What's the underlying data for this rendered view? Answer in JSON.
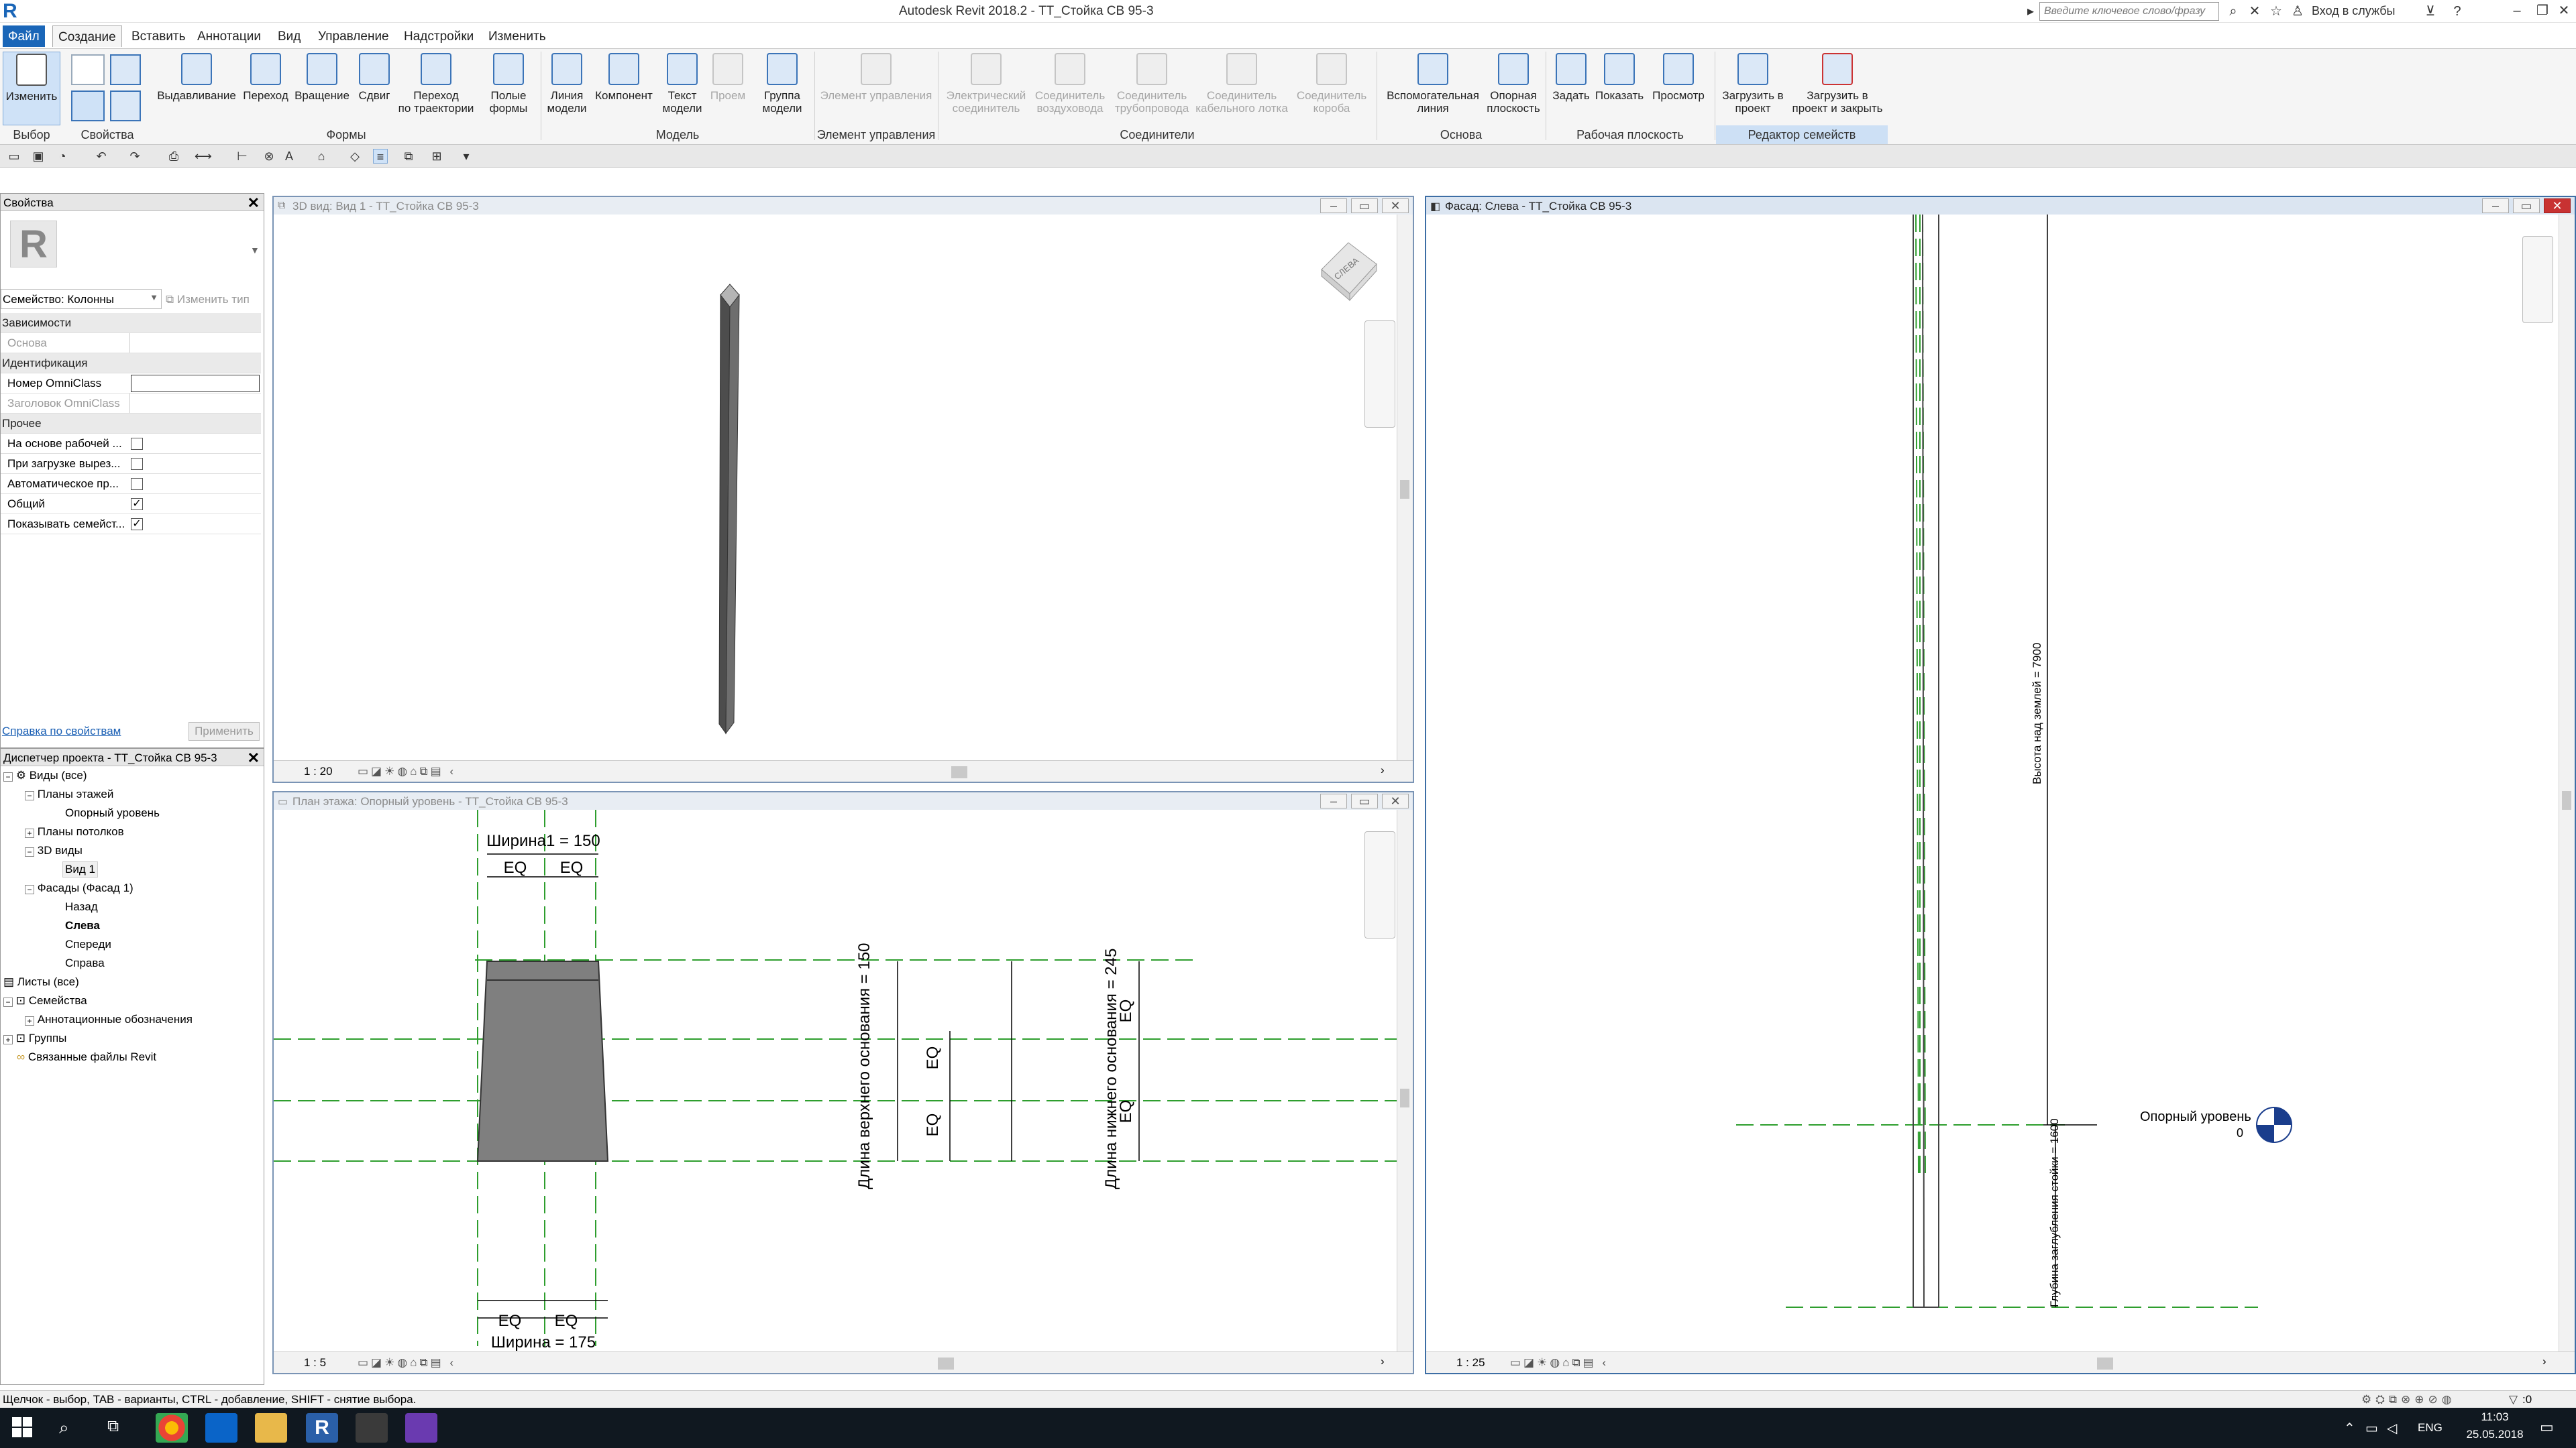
{
  "app": {
    "logo_letter": "R",
    "title": "Autodesk Revit 2018.2 -    ТТ_Стойка СВ 95-3",
    "search_placeholder": "Введите ключевое слово/фразу",
    "login": "Вход в службы"
  },
  "tabs": [
    "Файл",
    "Создание",
    "Вставить",
    "Аннотации",
    "Вид",
    "Управление",
    "Надстройки",
    "Изменить"
  ],
  "ribbon": {
    "buttons": [
      {
        "label": "Изменить",
        "disabled": false
      },
      {
        "label": "Выдавливание",
        "disabled": false
      },
      {
        "label": "Переход",
        "disabled": false
      },
      {
        "label": "Вращение",
        "disabled": false
      },
      {
        "label": "Сдвиг",
        "disabled": false
      },
      {
        "label": "Переход\nпо траектории",
        "disabled": false
      },
      {
        "label": "Полые\nформы",
        "disabled": false
      },
      {
        "label": "Линия\nмодели",
        "disabled": false
      },
      {
        "label": "Компонент",
        "disabled": false
      },
      {
        "label": "Текст\nмодели",
        "disabled": false
      },
      {
        "label": "Проем",
        "disabled": true
      },
      {
        "label": "Группа\nмодели",
        "disabled": false
      },
      {
        "label": "Элемент управления",
        "disabled": true
      },
      {
        "label": "Электрический\nсоединитель",
        "disabled": true
      },
      {
        "label": "Соединитель\nвоздуховода",
        "disabled": true
      },
      {
        "label": "Соединитель\nтрубопровода",
        "disabled": true
      },
      {
        "label": "Соединитель\nкабельного лотка",
        "disabled": true
      },
      {
        "label": "Соединитель\nкороба",
        "disabled": true
      },
      {
        "label": "Вспомогательная\nлиния",
        "disabled": false
      },
      {
        "label": "Опорная\nплоскость",
        "disabled": false
      },
      {
        "label": "Задать",
        "disabled": false
      },
      {
        "label": "Показать",
        "disabled": false
      },
      {
        "label": "Просмотр",
        "disabled": false
      },
      {
        "label": "Загрузить в\nпроект",
        "disabled": false
      },
      {
        "label": "Загрузить в\nпроект и закрыть",
        "disabled": false
      }
    ],
    "groups": [
      "Выбор",
      "Свойства",
      "Формы",
      "Модель",
      "Элемент управления",
      "Соединители",
      "Основа",
      "Рабочая плоскость",
      "Редактор семейств"
    ]
  },
  "properties": {
    "title": "Свойства",
    "type_selector": "Семейство: Колонны",
    "edit_type": "Изменить тип",
    "rows": [
      {
        "label": "Зависимости",
        "kind": "section"
      },
      {
        "label": "Основа",
        "kind": "disabled"
      },
      {
        "label": "Идентификация",
        "kind": "section"
      },
      {
        "label": "Номер OmniClass",
        "kind": "input"
      },
      {
        "label": "Заголовок OmniClass",
        "kind": "disabled"
      },
      {
        "label": "Прочее",
        "kind": "section"
      },
      {
        "label": "На основе рабочей ...",
        "kind": "check",
        "checked": false
      },
      {
        "label": "При загрузке вырез...",
        "kind": "check",
        "checked": false
      },
      {
        "label": "Автоматическое пр...",
        "kind": "check",
        "checked": false
      },
      {
        "label": "Общий",
        "kind": "check",
        "checked": true
      },
      {
        "label": "Показывать семейст...",
        "kind": "check",
        "checked": true
      }
    ],
    "help_link": "Справка по свойствам",
    "apply": "Применить"
  },
  "browser": {
    "title": "Диспетчер проекта - ТТ_Стойка СВ 95-3",
    "items": [
      {
        "label": "Виды (все)",
        "level": 0,
        "toggle": "−",
        "bold": false
      },
      {
        "label": "Планы этажей",
        "level": 1,
        "toggle": "−",
        "bold": false
      },
      {
        "label": "Опорный уровень",
        "level": 2,
        "toggle": "",
        "bold": false
      },
      {
        "label": "Планы потолков",
        "level": 1,
        "toggle": "+",
        "bold": false
      },
      {
        "label": "3D виды",
        "level": 1,
        "toggle": "−",
        "bold": false
      },
      {
        "label": "Вид 1",
        "level": 2,
        "toggle": "",
        "bold": false
      },
      {
        "label": "Фасады (Фасад 1)",
        "level": 1,
        "toggle": "−",
        "bold": false
      },
      {
        "label": "Назад",
        "level": 2,
        "toggle": "",
        "bold": false
      },
      {
        "label": "Слева",
        "level": 2,
        "toggle": "",
        "bold": true
      },
      {
        "label": "Спереди",
        "level": 2,
        "toggle": "",
        "bold": false
      },
      {
        "label": "Справа",
        "level": 2,
        "toggle": "",
        "bold": false
      },
      {
        "label": "Листы (все)",
        "level": 0,
        "toggle": "",
        "bold": false
      },
      {
        "label": "Семейства",
        "level": 0,
        "toggle": "+",
        "bold": false
      },
      {
        "label": "Аннотационные обозначения",
        "level": 1,
        "toggle": "+",
        "bold": false
      },
      {
        "label": "Группы",
        "level": 0,
        "toggle": "+",
        "bold": false
      },
      {
        "label": "Связанные файлы Revit",
        "level": 0,
        "toggle": "",
        "bold": false
      }
    ]
  },
  "views": {
    "v3d": {
      "title": "3D вид: Вид 1 - ТТ_Стойка СВ 95-3",
      "scale": "1 : 20",
      "cube": "СЛЕВА"
    },
    "plan": {
      "title": "План этажа: Опорный уровень - ТТ_Стойка СВ 95-3",
      "scale": "1 : 5",
      "dim_top": "Ширина1 = 150",
      "dim_bottom": "Ширина = 175",
      "eq": "EQ",
      "dim_upper_len": "Длина верхнего основания = 150",
      "dim_lower_len": "Длина нижнего основания = 245"
    },
    "elev": {
      "title": "Фасад: Слева - ТТ_Стойка СВ 95-3",
      "scale": "1 : 25",
      "dim_height": "Высота над землей = 7900",
      "dim_depth": "Глубина заглубления стойки = 1600",
      "level_name": "Опорный уровень",
      "level_value": "0"
    }
  },
  "status": "Щелчок - выбор, TAB - варианты, CTRL - добавление, SHIFT - снятие выбора.",
  "taskbar": {
    "lang": "ENG",
    "time": "11:03",
    "date": "25.05.2018",
    "status_count": ":0"
  },
  "colors": {
    "accent": "#1a66b8",
    "ref_plane": "#2e9e2e",
    "solid": "#7a7a7a"
  }
}
